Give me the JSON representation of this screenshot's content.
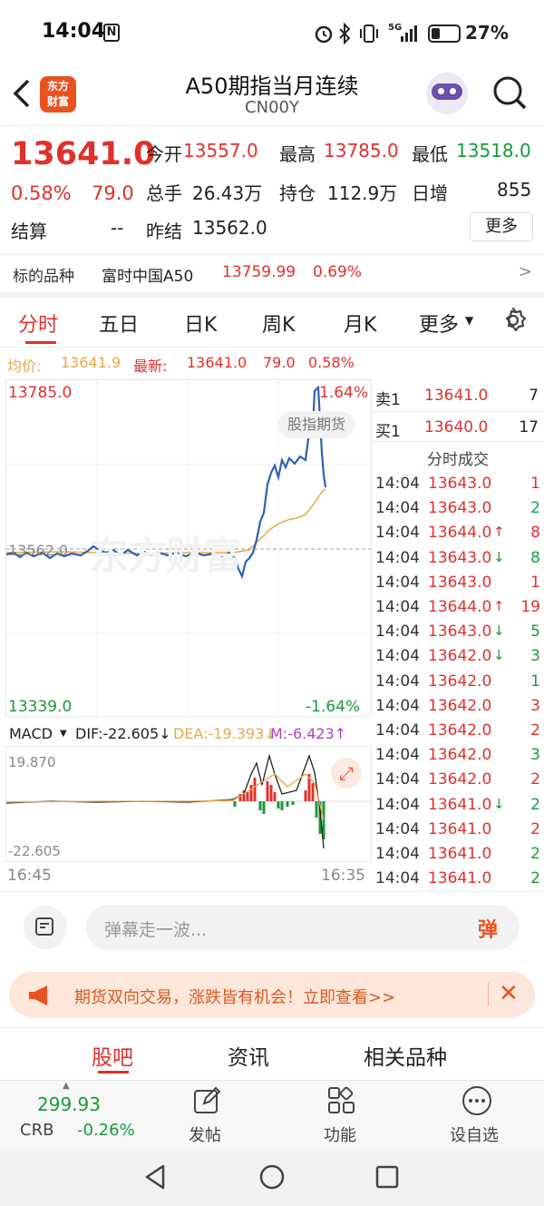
{
  "status_bar": {
    "time": "14:04",
    "battery": "27%",
    "network": "5G"
  },
  "header": {
    "brand_line1": "东方",
    "brand_line2": "财富",
    "title": "A50期指当月连续",
    "code": "CN00Y"
  },
  "quote": {
    "price": "13641.0",
    "change_pct": "0.58%",
    "change": "79.0",
    "open_label": "今开",
    "open": "13557.0",
    "high_label": "最高",
    "high": "13785.0",
    "low_label": "最低",
    "low": "13518.0",
    "volume_label": "总手",
    "volume": "26.43万",
    "oi_label": "持仓",
    "oi": "112.9万",
    "daily_inc_label": "日增",
    "daily_inc": "855",
    "settle_label": "结算",
    "settle": "--",
    "prev_settle_label": "昨结",
    "prev_settle": "13562.0",
    "more_btn": "更多"
  },
  "underlying": {
    "label": "标的品种",
    "name": "富时中国A50",
    "price": "13759.99",
    "pct": "0.69%",
    "chevron": ">"
  },
  "tabs": [
    "分时",
    "五日",
    "日K",
    "周K",
    "月K",
    "更多"
  ],
  "avg_line": {
    "avg_label": "均价:",
    "avg": "13641.9",
    "latest_label": "最新:",
    "latest": "13641.0",
    "chg": "79.0",
    "pct": "0.58%"
  },
  "chart": {
    "top_price": "13785.0",
    "top_pct": "1.64%",
    "bottom_price": "13339.0",
    "bottom_pct": "-1.64%",
    "prev_label": "13562.0",
    "tag": "股指期货",
    "watermark": "东方财富",
    "time_start": "16:45",
    "time_end": "16:35"
  },
  "macd": {
    "label": "MACD",
    "dif": "DIF:-22.605↓",
    "dea": "DEA:-19.393↓",
    "m": "M:-6.423↑",
    "top": "19.870",
    "bottom": "-22.605"
  },
  "orderbook": {
    "ask_label": "卖1",
    "ask_price": "13641.0",
    "ask_vol": "7",
    "bid_label": "买1",
    "bid_price": "13640.0",
    "bid_vol": "17",
    "trades_title": "分时成交"
  },
  "trades": [
    {
      "t": "14:04",
      "p": "13643.0",
      "a": "",
      "v": "1",
      "vc": "red"
    },
    {
      "t": "14:04",
      "p": "13643.0",
      "a": "",
      "v": "2",
      "vc": "green"
    },
    {
      "t": "14:04",
      "p": "13644.0",
      "a": "↑",
      "v": "8",
      "vc": "red"
    },
    {
      "t": "14:04",
      "p": "13643.0",
      "a": "↓",
      "v": "8",
      "vc": "green"
    },
    {
      "t": "14:04",
      "p": "13643.0",
      "a": "",
      "v": "1",
      "vc": "red"
    },
    {
      "t": "14:04",
      "p": "13644.0",
      "a": "↑",
      "v": "19",
      "vc": "red"
    },
    {
      "t": "14:04",
      "p": "13643.0",
      "a": "↓",
      "v": "5",
      "vc": "green"
    },
    {
      "t": "14:04",
      "p": "13642.0",
      "a": "↓",
      "v": "3",
      "vc": "green"
    },
    {
      "t": "14:04",
      "p": "13642.0",
      "a": "",
      "v": "1",
      "vc": "green"
    },
    {
      "t": "14:04",
      "p": "13642.0",
      "a": "",
      "v": "3",
      "vc": "red"
    },
    {
      "t": "14:04",
      "p": "13642.0",
      "a": "",
      "v": "2",
      "vc": "red"
    },
    {
      "t": "14:04",
      "p": "13642.0",
      "a": "",
      "v": "3",
      "vc": "green"
    },
    {
      "t": "14:04",
      "p": "13642.0",
      "a": "",
      "v": "2",
      "vc": "red"
    },
    {
      "t": "14:04",
      "p": "13641.0",
      "a": "↓",
      "v": "2",
      "vc": "green"
    },
    {
      "t": "14:04",
      "p": "13641.0",
      "a": "",
      "v": "2",
      "vc": "red"
    },
    {
      "t": "14:04",
      "p": "13641.0",
      "a": "",
      "v": "2",
      "vc": "green"
    },
    {
      "t": "14:04",
      "p": "13641.0",
      "a": "",
      "v": "2",
      "vc": "green"
    }
  ],
  "comment": {
    "placeholder": "弹幕走一波...",
    "danmu_icon": "弹"
  },
  "banner": {
    "text": "期货双向交易，涨跌皆有机会！立即查看>>"
  },
  "section_tabs": [
    "股吧",
    "资讯",
    "相关品种"
  ],
  "bottom": {
    "price": "299.93",
    "name": "CRB",
    "pct": "-0.26%",
    "post": "发帖",
    "func": "功能",
    "watch": "设自选"
  },
  "colors": {
    "up": "#e0312d",
    "down": "#1a9a3a",
    "accent": "#e8521f",
    "avg": "#e8a84a",
    "line": "#2e62b3"
  }
}
